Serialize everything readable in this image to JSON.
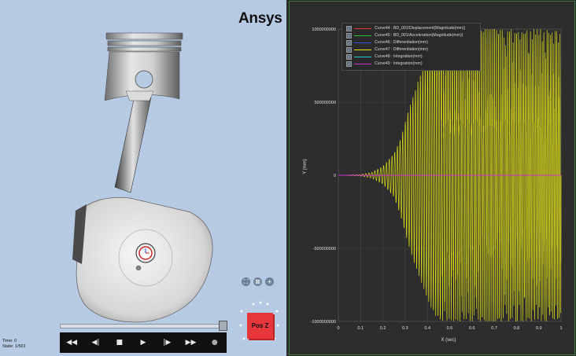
{
  "viewer": {
    "brand": "Ansys",
    "time_text": "Time: 0",
    "state_text": "State: 1/501",
    "orientation_label": "Pos Z",
    "view_controls": [
      {
        "icon": "fit-view-icon",
        "glyph": "⛶"
      },
      {
        "icon": "zoom-box-icon",
        "glyph": "⊠"
      },
      {
        "icon": "zoom-in-icon",
        "glyph": "+"
      }
    ],
    "playback": [
      {
        "name": "rewind-button",
        "glyph": "◀◀"
      },
      {
        "name": "step-back-button",
        "glyph": "◀|"
      },
      {
        "name": "stop-button",
        "glyph": "■"
      },
      {
        "name": "play-button",
        "glyph": "▶"
      },
      {
        "name": "step-forward-button",
        "glyph": "|▶"
      },
      {
        "name": "fast-forward-button",
        "glyph": "▶▶"
      },
      {
        "name": "record-button",
        "glyph": "●"
      }
    ],
    "timeline_fraction": 1.0
  },
  "chart_data": {
    "type": "line",
    "xlabel": "X (sec)",
    "ylabel": "Y (mm)",
    "xlim": [
      0,
      1
    ],
    "ylim": [
      -1000000000,
      1000000000
    ],
    "x_ticks": [
      "0",
      "0.1",
      "0.2",
      "0.3",
      "0.4",
      "0.5",
      "0.6",
      "0.7",
      "0.8",
      "0.9",
      "1"
    ],
    "y_ticks": [
      {
        "label": "1000000000",
        "value": 1000000000
      },
      {
        "label": "500000000",
        "value": 500000000
      },
      {
        "label": "0",
        "value": 0
      },
      {
        "label": "-500000000",
        "value": -500000000
      },
      {
        "label": "-1000000000",
        "value": -1000000000
      }
    ],
    "grid": true,
    "legend_placement": "top-left",
    "series": [
      {
        "name": "Curve44 : BD_001/Displacement(Magnitude(mm))",
        "color": "#e03030",
        "visible": true
      },
      {
        "name": "Curve45 : BD_001/Acceleration(Magnitude(mm))",
        "color": "#30c030",
        "visible": true
      },
      {
        "name": "Curve46 : Differentiation(mm)",
        "color": "#3050e0",
        "visible": true
      },
      {
        "name": "Curve47 : Differentiation(mm)",
        "color": "#e6e61a",
        "visible": true
      },
      {
        "name": "Curve48 : Integration(mm)",
        "color": "#20c8c8",
        "visible": true
      },
      {
        "name": "Curve49 : Integration(mm)",
        "color": "#d030d0",
        "visible": true
      }
    ],
    "oscillation_envelope": {
      "series": "Curve47 : Differentiation(mm)",
      "points": [
        {
          "x": 0.0,
          "top": 0,
          "bottom": 0
        },
        {
          "x": 0.1,
          "top": 5000000,
          "bottom": -5000000
        },
        {
          "x": 0.15,
          "top": 20000000,
          "bottom": -20000000
        },
        {
          "x": 0.2,
          "top": 60000000,
          "bottom": -60000000
        },
        {
          "x": 0.25,
          "top": 150000000,
          "bottom": -150000000
        },
        {
          "x": 0.28,
          "top": 250000000,
          "bottom": -280000000
        },
        {
          "x": 0.31,
          "top": 420000000,
          "bottom": -450000000
        },
        {
          "x": 0.34,
          "top": 560000000,
          "bottom": -600000000
        },
        {
          "x": 0.37,
          "top": 700000000,
          "bottom": -720000000
        },
        {
          "x": 0.4,
          "top": 820000000,
          "bottom": -850000000
        },
        {
          "x": 0.43,
          "top": 920000000,
          "bottom": -950000000
        },
        {
          "x": 0.46,
          "top": 1000000000,
          "bottom": -1000000000
        },
        {
          "x": 0.6,
          "top": 1000000000,
          "bottom": -1000000000
        },
        {
          "x": 0.8,
          "top": 1000000000,
          "bottom": -1000000000
        },
        {
          "x": 1.0,
          "top": 1000000000,
          "bottom": -1000000000
        }
      ],
      "inner_band": {
        "from_x": 0.46,
        "top": 380000000,
        "bottom": -560000000
      }
    },
    "flat_series_value": 0
  }
}
